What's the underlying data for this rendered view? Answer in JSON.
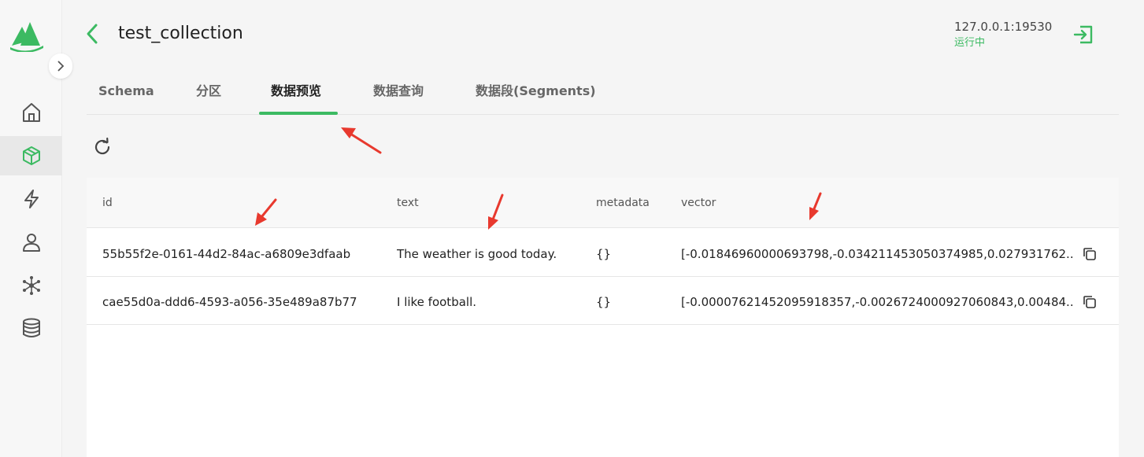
{
  "header": {
    "title": "test_collection",
    "server_address": "127.0.0.1:19530",
    "server_status": "运行中"
  },
  "tabs": [
    {
      "label": "Schema",
      "active": false
    },
    {
      "label": "分区",
      "active": false
    },
    {
      "label": "数据预览",
      "active": true
    },
    {
      "label": "数据查询",
      "active": false
    },
    {
      "label": "数据段(Segments)",
      "active": false
    }
  ],
  "sidebar": {
    "items": [
      {
        "icon": "home-icon",
        "active": false
      },
      {
        "icon": "cube-icon",
        "active": true
      },
      {
        "icon": "lightning-icon",
        "active": false
      },
      {
        "icon": "user-icon",
        "active": false
      },
      {
        "icon": "network-icon",
        "active": false
      },
      {
        "icon": "database-icon",
        "active": false
      }
    ]
  },
  "table": {
    "columns": [
      "id",
      "text",
      "metadata",
      "vector"
    ],
    "rows": [
      {
        "id": "55b55f2e-0161-44d2-84ac-a6809e3dfaab",
        "text": "The weather is good today.",
        "metadata": "{}",
        "vector": "[-0.01846960000693798,-0.034211453050374985,0.027931762..."
      },
      {
        "id": "cae55d0a-ddd6-4593-a056-35e489a87b77",
        "text": "I like football.",
        "metadata": "{}",
        "vector": "[-0.00007621452095918357,-0.0026724000927060843,0.00484..."
      }
    ]
  },
  "colors": {
    "accent": "#3cba62",
    "annotation": "#e8392e"
  }
}
